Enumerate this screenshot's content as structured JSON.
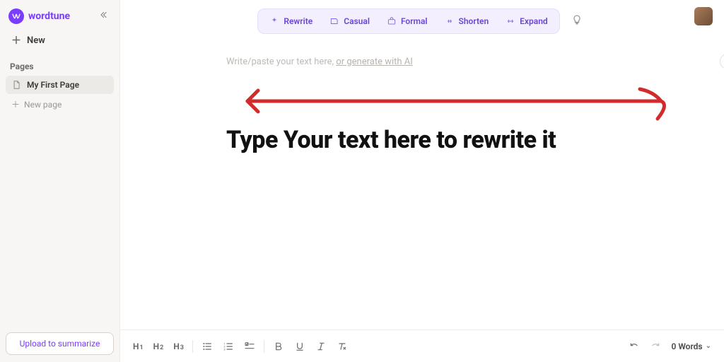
{
  "brand": {
    "name": "wordtune"
  },
  "sidebar": {
    "new_label": "New",
    "pages_label": "Pages",
    "pages": [
      {
        "label": "My First Page"
      }
    ],
    "new_page_label": "New page",
    "upload_label": "Upload to summarize"
  },
  "toolbar": {
    "rewrite": "Rewrite",
    "casual": "Casual",
    "formal": "Formal",
    "shorten": "Shorten",
    "expand": "Expand"
  },
  "editor": {
    "placeholder_prefix": "Write/paste your text here, ",
    "placeholder_ai": "or generate with AI",
    "hero": "Type Your text here to rewrite it"
  },
  "format": {
    "h1": "H",
    "h1sub": "1",
    "h2": "H",
    "h2sub": "2",
    "h3": "H",
    "h3sub": "3"
  },
  "footer": {
    "word_count": "0 Words"
  },
  "annotation": {
    "color": "#d22b2b"
  }
}
